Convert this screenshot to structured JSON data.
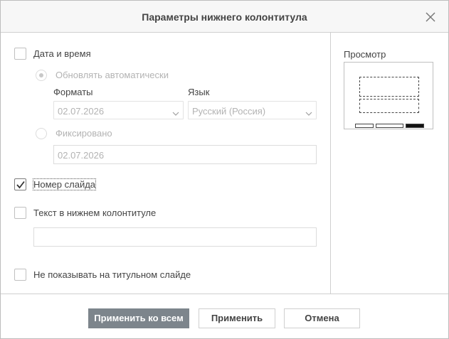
{
  "dialog": {
    "title": "Параметры нижнего колонтитула"
  },
  "date_time": {
    "label": "Дата и время",
    "checked": false,
    "auto_update_label": "Обновлять автоматически",
    "formats_label": "Форматы",
    "format_value": "02.07.2026",
    "language_label": "Язык",
    "language_value": "Русский (Россия)",
    "fixed_label": "Фиксировано",
    "fixed_value": "02.07.2026"
  },
  "slide_number": {
    "label": "Номер слайда",
    "checked": true
  },
  "footer_text": {
    "label": "Текст в нижнем колонтитуле",
    "checked": false,
    "value": ""
  },
  "title_slide": {
    "label": "Не показывать на титульном слайде",
    "checked": false
  },
  "preview": {
    "label": "Просмотр"
  },
  "buttons": {
    "apply_all": "Применить ко всем",
    "apply": "Применить",
    "cancel": "Отмена"
  },
  "colors": {
    "primary_button": "#7d858c",
    "header_bg": "#f7f7f7",
    "disabled_text": "#b3b3b3"
  },
  "icons": {
    "close": "close-icon",
    "check": "checkmark-icon",
    "dropdown": "chevron-down-icon"
  }
}
